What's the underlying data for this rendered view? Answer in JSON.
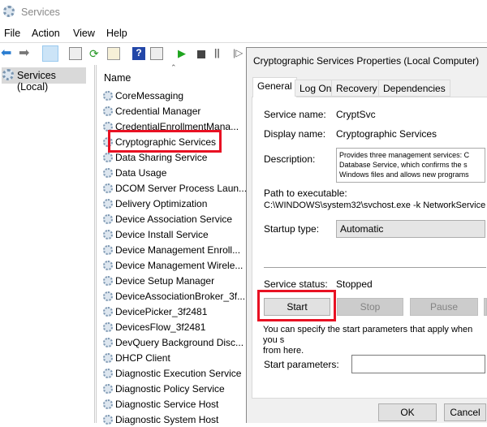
{
  "window": {
    "title": "Services"
  },
  "menu": [
    "File",
    "Action",
    "View",
    "Help"
  ],
  "tree": {
    "root": "Services (Local)"
  },
  "list": {
    "column": "Name",
    "items": [
      "CoreMessaging",
      "Credential Manager",
      "CredentialEnrollmentMana...",
      "Cryptographic Services",
      "Data Sharing Service",
      "Data Usage",
      "DCOM Server Process Laun...",
      "Delivery Optimization",
      "Device Association Service",
      "Device Install Service",
      "Device Management Enroll...",
      "Device Management Wirele...",
      "Device Setup Manager",
      "DeviceAssociationBroker_3f...",
      "DevicePicker_3f2481",
      "DevicesFlow_3f2481",
      "DevQuery Background Disc...",
      "DHCP Client",
      "Diagnostic Execution Service",
      "Diagnostic Policy Service",
      "Diagnostic Service Host",
      "Diagnostic System Host"
    ],
    "highlighted": "Cryptographic Services"
  },
  "dialog": {
    "title": "Cryptographic Services Properties (Local Computer)",
    "tabs": [
      "General",
      "Log On",
      "Recovery",
      "Dependencies"
    ],
    "service_name_label": "Service name:",
    "service_name": "CryptSvc",
    "display_name_label": "Display name:",
    "display_name": "Cryptographic Services",
    "description_label": "Description:",
    "description_lines": [
      "Provides three management services: C",
      "Database Service, which confirms the s",
      "Windows files and allows new programs"
    ],
    "path_label": "Path to executable:",
    "path": "C:\\WINDOWS\\system32\\svchost.exe -k NetworkService",
    "startup_label": "Startup type:",
    "startup_value": "Automatic",
    "status_label": "Service status:",
    "status_value": "Stopped",
    "buttons": {
      "start": "Start",
      "stop": "Stop",
      "pause": "Pause",
      "ok": "OK",
      "cancel": "Cancel"
    },
    "hint_lines": [
      "You can specify the start parameters that apply when you s",
      "from here."
    ],
    "params_label": "Start parameters:",
    "params_value": ""
  },
  "colors": {
    "highlight": "#e81123",
    "play": "#1fa51f"
  }
}
